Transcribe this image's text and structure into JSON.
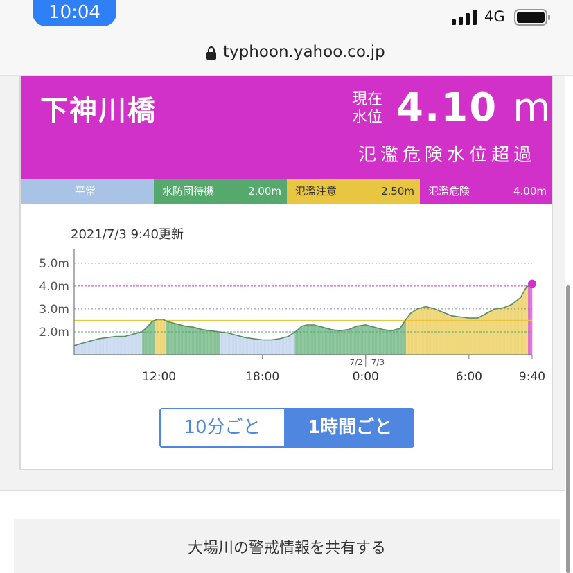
{
  "status_bar": {
    "time": "10:04",
    "network": "4G"
  },
  "browser": {
    "url": "typhoon.yahoo.co.jp"
  },
  "station": {
    "name": "下神川橋",
    "level_label_line1": "現在",
    "level_label_line2": "水位",
    "level_value": "4.10",
    "level_unit": "m",
    "status": "氾濫危険水位超過"
  },
  "legend": {
    "normal": {
      "label": "平常"
    },
    "standby": {
      "label": "水防団待機",
      "value": "2.00m"
    },
    "caution": {
      "label": "氾濫注意",
      "value": "2.50m"
    },
    "danger": {
      "label": "氾濫危険",
      "value": "4.00m"
    }
  },
  "updated": "2021/7/3 9:40更新",
  "colors": {
    "danger": "#d131c8",
    "caution": "#e8c641",
    "standby": "#55a96c",
    "normal": "#a9c3e6",
    "accent": "#4f86e0"
  },
  "chart_data": {
    "type": "area",
    "y_tick_labels": [
      "5.0m",
      "4.0m",
      "3.0m",
      "2.0m"
    ],
    "y_ticks": [
      5.0,
      4.0,
      3.0,
      2.0
    ],
    "ylim": [
      1.0,
      5.6
    ],
    "x_tick_labels": [
      "12:00",
      "18:00",
      "0:00",
      "6:00",
      "9:40"
    ],
    "x_ticks": [
      12,
      18,
      24,
      30,
      33.667
    ],
    "xlim": [
      7.067,
      33.667
    ],
    "date_labels": [
      "7/2",
      "7/3"
    ],
    "thresholds": {
      "standby": 2.0,
      "caution": 2.5,
      "danger": 4.0
    },
    "series": [
      {
        "x": [
          7.067,
          7.5,
          8,
          8.5,
          9,
          9.5,
          10,
          10.5,
          11,
          11.3,
          11.6,
          11.9,
          12.2,
          12.5,
          13,
          13.5,
          14,
          14.5,
          15,
          15.5,
          16,
          16.5,
          17,
          17.5,
          18,
          18.5,
          19,
          19.5,
          20,
          20.3,
          20.6,
          21,
          21.5,
          22,
          22.5,
          23,
          23.5,
          24,
          24.5,
          25,
          25.5,
          26,
          26.3,
          26.6,
          27,
          27.5,
          28,
          28.5,
          29,
          29.5,
          30,
          30.5,
          31,
          31.5,
          32,
          32.5,
          33,
          33.33,
          33.667
        ],
        "y": [
          1.4,
          1.5,
          1.6,
          1.7,
          1.75,
          1.8,
          1.8,
          1.9,
          2.0,
          2.2,
          2.45,
          2.55,
          2.55,
          2.45,
          2.35,
          2.25,
          2.2,
          2.1,
          2.05,
          2.0,
          1.95,
          1.85,
          1.75,
          1.7,
          1.65,
          1.65,
          1.7,
          1.8,
          2.05,
          2.25,
          2.3,
          2.3,
          2.2,
          2.1,
          2.05,
          2.1,
          2.25,
          2.3,
          2.2,
          2.1,
          2.05,
          2.15,
          2.5,
          2.8,
          3.0,
          3.1,
          3.0,
          2.85,
          2.7,
          2.65,
          2.6,
          2.6,
          2.8,
          3.0,
          3.05,
          3.2,
          3.5,
          3.95,
          4.1
        ]
      }
    ]
  },
  "toggle": {
    "option_10min": "10分ごと",
    "option_1hour": "1時間ごと"
  },
  "share": {
    "label": "大場川の警戒情報を共有する"
  }
}
